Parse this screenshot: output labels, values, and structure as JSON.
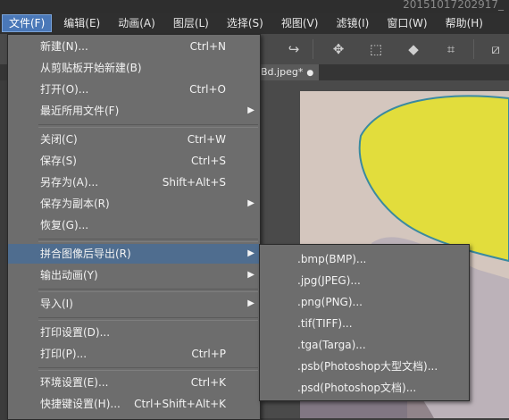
{
  "window": {
    "title": "20151017202917_"
  },
  "menubar": [
    {
      "label": "文件(F)",
      "active": true
    },
    {
      "label": "编辑(E)"
    },
    {
      "label": "动画(A)"
    },
    {
      "label": "图层(L)"
    },
    {
      "label": "选择(S)"
    },
    {
      "label": "视图(V)"
    },
    {
      "label": "滤镜(I)"
    },
    {
      "label": "窗口(W)"
    },
    {
      "label": "帮助(H)"
    }
  ],
  "document_tab": {
    "label": "Bd.jpeg*",
    "close": "●"
  },
  "file_menu": {
    "items": [
      {
        "label": "新建(N)...",
        "shortcut": "Ctrl+N"
      },
      {
        "label": "从剪贴板开始新建(B)",
        "shortcut": ""
      },
      {
        "label": "打开(O)...",
        "shortcut": "Ctrl+O"
      },
      {
        "label": "最近所用文件(F)",
        "shortcut": "",
        "submenu": true
      },
      {
        "label": "关闭(C)",
        "shortcut": "Ctrl+W"
      },
      {
        "label": "保存(S)",
        "shortcut": "Ctrl+S"
      },
      {
        "label": "另存为(A)...",
        "shortcut": "Shift+Alt+S"
      },
      {
        "label": "保存为副本(R)",
        "shortcut": "",
        "submenu": true
      },
      {
        "label": "恢复(G)...",
        "shortcut": ""
      },
      {
        "label": "拼合图像后导出(R)",
        "shortcut": "",
        "submenu": true,
        "highlighted": true
      },
      {
        "label": "输出动画(Y)",
        "shortcut": "",
        "submenu": true
      },
      {
        "label": "导入(I)",
        "shortcut": "",
        "submenu": true
      },
      {
        "label": "打印设置(D)...",
        "shortcut": ""
      },
      {
        "label": "打印(P)...",
        "shortcut": "Ctrl+P"
      },
      {
        "label": "环境设置(E)...",
        "shortcut": "Ctrl+K"
      },
      {
        "label": "快捷键设置(H)...",
        "shortcut": "Ctrl+Shift+Alt+K"
      }
    ]
  },
  "export_submenu": {
    "items": [
      ".bmp(BMP)...",
      ".jpg(JPEG)...",
      ".png(PNG)...",
      ".tif(TIFF)...",
      ".tga(Targa)...",
      ".psb(Photoshop大型文档)...",
      ".psd(Photoshop文档)..."
    ]
  },
  "colors": {
    "menu_bg": "#6d6d6d",
    "highlight": "#4f6d8f",
    "menubar_active": "#4a78b8"
  },
  "icons": [
    "redo-icon",
    "select-tool-icon",
    "bucket-icon",
    "transform-icon",
    "slash-icon"
  ]
}
